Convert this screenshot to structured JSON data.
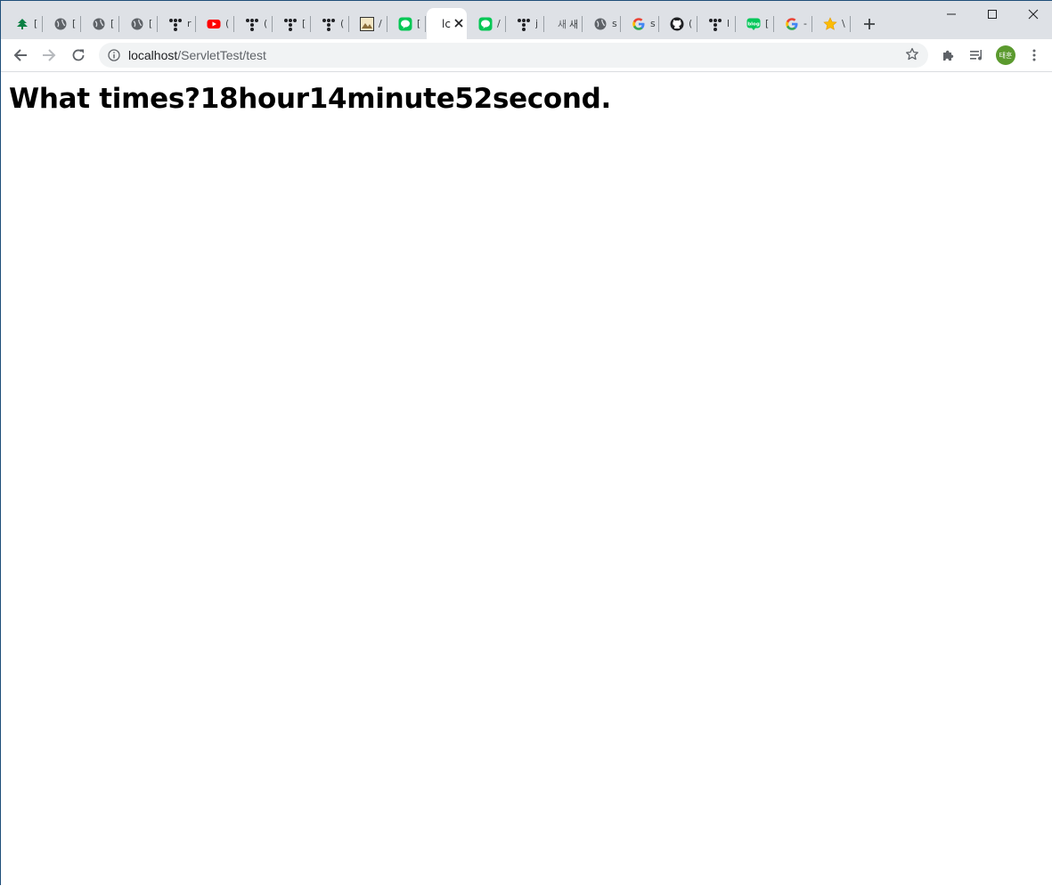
{
  "tabs": [
    {
      "icon": "tree-icon",
      "title": "[",
      "color": "#0b8043"
    },
    {
      "icon": "globe-icon",
      "title": "[",
      "color": "#5f6368"
    },
    {
      "icon": "globe-icon",
      "title": "[",
      "color": "#5f6368"
    },
    {
      "icon": "globe-icon",
      "title": "[",
      "color": "#5f6368"
    },
    {
      "icon": "tistory-icon",
      "title": "r",
      "color": "#202124"
    },
    {
      "icon": "youtube-icon",
      "title": "(",
      "color": "#ff0000"
    },
    {
      "icon": "tistory-icon",
      "title": "(",
      "color": "#202124"
    },
    {
      "icon": "tistory-icon",
      "title": "[",
      "color": "#202124"
    },
    {
      "icon": "tistory-icon",
      "title": "(",
      "color": "#202124"
    },
    {
      "icon": "image-icon",
      "title": "/",
      "color": "#8a6d3b"
    },
    {
      "icon": "line-icon",
      "title": "[",
      "color": "#06c755"
    },
    {
      "icon": "none",
      "title": "lc",
      "active": true
    },
    {
      "icon": "line-icon",
      "title": "/",
      "color": "#06c755"
    },
    {
      "icon": "tistory-icon",
      "title": "j",
      "color": "#202124"
    },
    {
      "icon": "korean-text-icon",
      "title": "새 탭",
      "color": "#5f6368"
    },
    {
      "icon": "globe-icon",
      "title": "s",
      "color": "#5f6368"
    },
    {
      "icon": "google-icon",
      "title": "s",
      "color": "#4285f4"
    },
    {
      "icon": "github-icon",
      "title": "(",
      "color": "#202124"
    },
    {
      "icon": "tistory-icon",
      "title": "l",
      "color": "#202124"
    },
    {
      "icon": "naver-blog-icon",
      "title": "[",
      "color": "#03c75a"
    },
    {
      "icon": "google-icon",
      "title": "-",
      "color": "#4285f4"
    },
    {
      "icon": "star-icon",
      "title": "\\",
      "color": "#fbbc04"
    }
  ],
  "address": {
    "host": "localhost",
    "path": "/ServletTest/test"
  },
  "profile": {
    "initials": "태훈",
    "color": "#5b9a2e"
  },
  "page": {
    "message": "What times?18hour14minute52second."
  }
}
